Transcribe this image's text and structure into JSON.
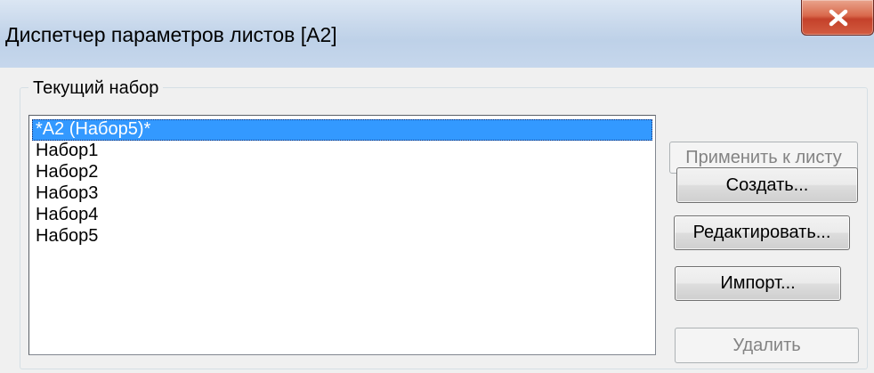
{
  "window": {
    "title": "Диспетчер параметров листов [A2]",
    "close_symbol": "×"
  },
  "group": {
    "label": "Текущий набор"
  },
  "list": {
    "items": [
      {
        "label": "*A2 (Набор5)*",
        "selected": true
      },
      {
        "label": "Набор1",
        "selected": false
      },
      {
        "label": "Набор2",
        "selected": false
      },
      {
        "label": "Набор3",
        "selected": false
      },
      {
        "label": "Набор4",
        "selected": false
      },
      {
        "label": "Набор5",
        "selected": false
      }
    ]
  },
  "buttons": {
    "apply": {
      "label": "Применить к листу",
      "enabled": false
    },
    "create": {
      "label": "Создать...",
      "enabled": true
    },
    "edit": {
      "label": "Редактировать...",
      "enabled": true
    },
    "import": {
      "label": "Импорт...",
      "enabled": true
    },
    "delete": {
      "label": "Удалить",
      "enabled": false
    }
  },
  "colors": {
    "selection": "#3399ff",
    "close_button": "#c4412a"
  },
  "icons": {
    "close": "close-icon"
  }
}
